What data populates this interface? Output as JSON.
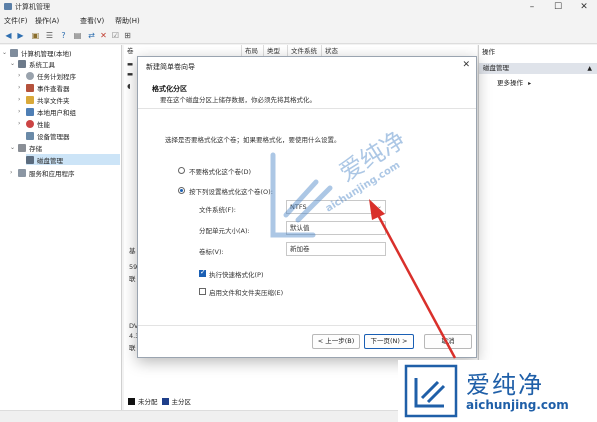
{
  "window": {
    "title": "计算机管理"
  },
  "menu": [
    "文件(F)",
    "操作(A)",
    "查看(V)",
    "帮助(H)"
  ],
  "tree": {
    "root": "计算机管理(本地)",
    "system_tools": "系统工具",
    "items": [
      "任务计划程序",
      "事件查看器",
      "共享文件夹",
      "本地用户和组",
      "性能",
      "设备管理器"
    ],
    "storage": "存储",
    "disk_mgmt": "磁盘管理",
    "services": "服务和应用程序"
  },
  "columns": [
    "卷",
    "布局",
    "类型",
    "文件系统",
    "状态"
  ],
  "disks": {
    "d1a": "基",
    "d1b": "59",
    "d1c": "联",
    "d2a": "DV",
    "d2b": "4.3",
    "d2c": "联"
  },
  "legend": {
    "unalloc": "未分配",
    "primary": "主分区"
  },
  "actions": {
    "header": "操作",
    "selected": "磁盘管理",
    "more": "更多操作"
  },
  "dialog": {
    "title": "新建简单卷向导",
    "heading": "格式化分区",
    "subheading": "要在这个磁盘分区上储存数据，你必须先将其格式化。",
    "prompt": "选择是否要格式化这个卷；如果要格式化，要使用什么设置。",
    "opt_no": "不要格式化这个卷(D)",
    "opt_yes": "按下列设置格式化这个卷(O):",
    "fs_label": "文件系统(F):",
    "fs_value": "NTFS",
    "au_label": "分配单元大小(A):",
    "au_value": "默认值",
    "vl_label": "卷标(V):",
    "vl_value": "新加卷",
    "quick": "执行快速格式化(P)",
    "compress": "启用文件和文件夹压缩(E)",
    "back": "< 上一步(B)",
    "next": "下一页(N) >",
    "cancel": "取消"
  },
  "watermark": {
    "text": "爱纯净",
    "url": "aichunjing.com"
  },
  "colors": {
    "accent": "#1a5fb4",
    "arrow": "#d9302b",
    "watermark": "#1f5fa8"
  }
}
